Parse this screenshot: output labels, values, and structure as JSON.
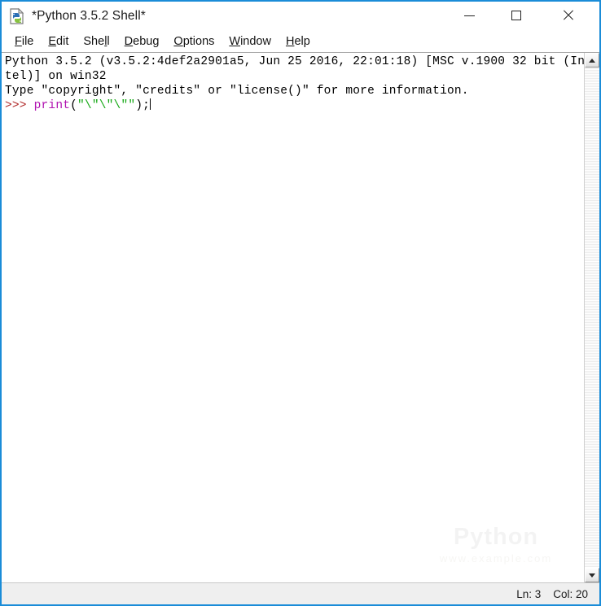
{
  "window": {
    "title": "*Python 3.5.2 Shell*",
    "icon": "idle-python-icon",
    "border_color": "#1a8cd8",
    "controls": {
      "minimize_label": "Minimize",
      "maximize_label": "Maximize",
      "close_label": "Close"
    }
  },
  "menubar": {
    "items": [
      {
        "label": "File",
        "pre": "",
        "mnemonic": "F",
        "post": "ile"
      },
      {
        "label": "Edit",
        "pre": "",
        "mnemonic": "E",
        "post": "dit"
      },
      {
        "label": "Shell",
        "pre": "She",
        "mnemonic": "l",
        "post": "l"
      },
      {
        "label": "Debug",
        "pre": "",
        "mnemonic": "D",
        "post": "ebug"
      },
      {
        "label": "Options",
        "pre": "",
        "mnemonic": "O",
        "post": "ptions"
      },
      {
        "label": "Window",
        "pre": "",
        "mnemonic": "W",
        "post": "indow"
      },
      {
        "label": "Help",
        "pre": "",
        "mnemonic": "H",
        "post": "elp"
      }
    ]
  },
  "shell": {
    "banner_line_1": "Python 3.5.2 (v3.5.2:4def2a2901a5, Jun 25 2016, 22:01:18) [MSC v.1900 32 bit (In",
    "banner_line_2": "tel)] on win32",
    "banner_line_3": "Type \"copyright\", \"credits\" or \"license()\" for more information.",
    "prompt": ">>> ",
    "code_builtin": "print",
    "code_open_paren": "(",
    "code_string": "\"\\\"\\\"\\\"\"",
    "code_tail": ");",
    "colors": {
      "prompt": "#b02828",
      "builtin": "#b114b1",
      "string": "#14a814",
      "plain": "#000000",
      "background": "#ffffff"
    }
  },
  "watermark": {
    "main": "Python",
    "sub": "www.example.com"
  },
  "scrollbar": {
    "up_arrow": "scroll-up-arrow-icon",
    "down_arrow": "scroll-down-arrow-icon"
  },
  "statusbar": {
    "line_label": "Ln: 3",
    "col_label": "Col: 20"
  }
}
